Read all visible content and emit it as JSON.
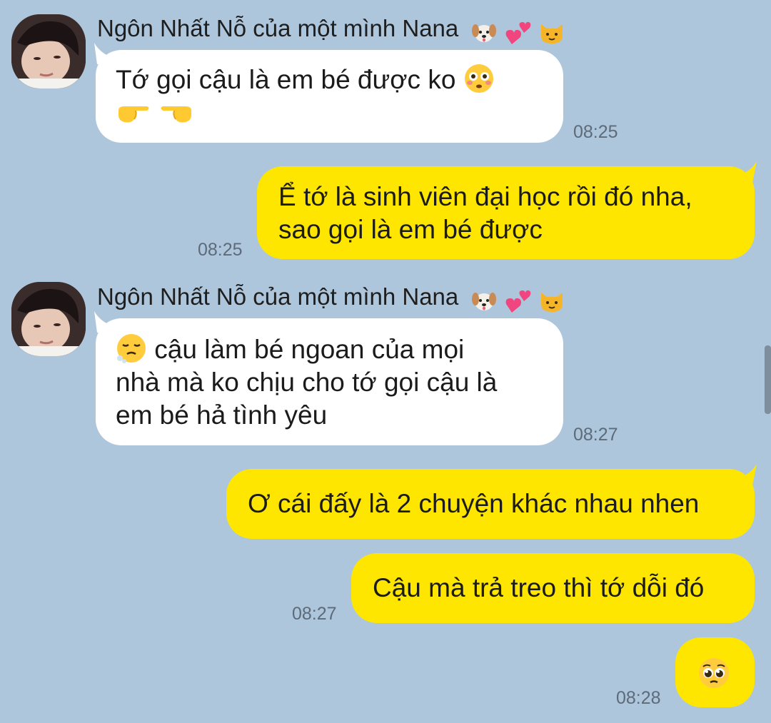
{
  "sender": {
    "name": "Ngôn Nhất Nỗ của một mình Nana"
  },
  "messages": [
    {
      "id": "m1",
      "direction": "incoming",
      "lines": [
        "Tớ gọi cậu là em bé được ko"
      ],
      "time": "08:25"
    },
    {
      "id": "m2",
      "direction": "outgoing",
      "lines": [
        "Ể tớ là sinh viên đại học rồi đó nha,",
        "sao gọi là em bé được"
      ],
      "time": "08:25"
    },
    {
      "id": "m3",
      "direction": "incoming",
      "lines": [
        "cậu làm bé ngoan của mọi",
        "nhà mà ko chịu cho tớ gọi cậu là",
        "em bé hả tình yêu"
      ],
      "time": "08:27"
    },
    {
      "id": "m4",
      "direction": "outgoing",
      "lines": [
        "Ơ cái đấy là 2 chuyện khác nhau nhen"
      ],
      "time": ""
    },
    {
      "id": "m5",
      "direction": "outgoing",
      "lines": [
        "Cậu mà trả treo thì tớ dỗi đó"
      ],
      "time": "08:27"
    },
    {
      "id": "m6",
      "direction": "outgoing",
      "lines": [],
      "time": "08:28"
    }
  ],
  "colors": {
    "background": "#aec6dc",
    "incoming_bubble": "#ffffff",
    "outgoing_bubble": "#fee600",
    "timestamp": "#5d6b79"
  },
  "icons": {
    "name_emojis": [
      "dog-face-icon",
      "two-hearts-icon",
      "cat-face-icon"
    ],
    "m1_emojis": [
      "flushed-face-icon",
      "pointing-right-icon",
      "pointing-left-icon"
    ],
    "m3_emoji": "face-exhaling-icon",
    "m6_emoji": "pleading-face-icon"
  }
}
